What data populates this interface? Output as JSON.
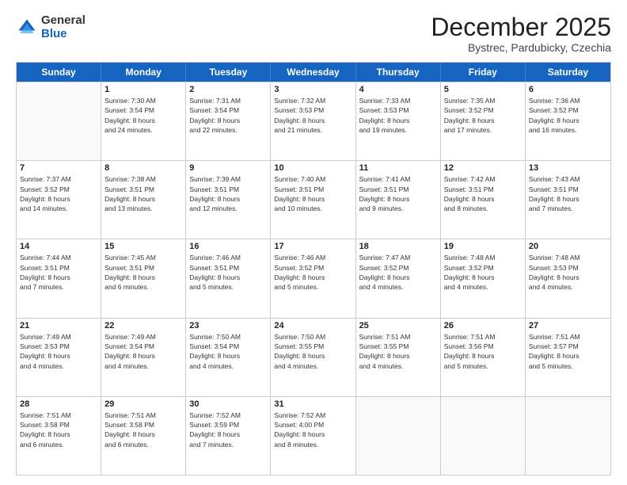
{
  "logo": {
    "general": "General",
    "blue": "Blue"
  },
  "header": {
    "month": "December 2025",
    "location": "Bystrec, Pardubicky, Czechia"
  },
  "weekdays": [
    "Sunday",
    "Monday",
    "Tuesday",
    "Wednesday",
    "Thursday",
    "Friday",
    "Saturday"
  ],
  "weeks": [
    [
      {
        "date": "",
        "info": ""
      },
      {
        "date": "1",
        "info": "Sunrise: 7:30 AM\nSunset: 3:54 PM\nDaylight: 8 hours\nand 24 minutes."
      },
      {
        "date": "2",
        "info": "Sunrise: 7:31 AM\nSunset: 3:54 PM\nDaylight: 8 hours\nand 22 minutes."
      },
      {
        "date": "3",
        "info": "Sunrise: 7:32 AM\nSunset: 3:53 PM\nDaylight: 8 hours\nand 21 minutes."
      },
      {
        "date": "4",
        "info": "Sunrise: 7:33 AM\nSunset: 3:53 PM\nDaylight: 8 hours\nand 19 minutes."
      },
      {
        "date": "5",
        "info": "Sunrise: 7:35 AM\nSunset: 3:52 PM\nDaylight: 8 hours\nand 17 minutes."
      },
      {
        "date": "6",
        "info": "Sunrise: 7:36 AM\nSunset: 3:52 PM\nDaylight: 8 hours\nand 16 minutes."
      }
    ],
    [
      {
        "date": "7",
        "info": "Sunrise: 7:37 AM\nSunset: 3:52 PM\nDaylight: 8 hours\nand 14 minutes."
      },
      {
        "date": "8",
        "info": "Sunrise: 7:38 AM\nSunset: 3:51 PM\nDaylight: 8 hours\nand 13 minutes."
      },
      {
        "date": "9",
        "info": "Sunrise: 7:39 AM\nSunset: 3:51 PM\nDaylight: 8 hours\nand 12 minutes."
      },
      {
        "date": "10",
        "info": "Sunrise: 7:40 AM\nSunset: 3:51 PM\nDaylight: 8 hours\nand 10 minutes."
      },
      {
        "date": "11",
        "info": "Sunrise: 7:41 AM\nSunset: 3:51 PM\nDaylight: 8 hours\nand 9 minutes."
      },
      {
        "date": "12",
        "info": "Sunrise: 7:42 AM\nSunset: 3:51 PM\nDaylight: 8 hours\nand 8 minutes."
      },
      {
        "date": "13",
        "info": "Sunrise: 7:43 AM\nSunset: 3:51 PM\nDaylight: 8 hours\nand 7 minutes."
      }
    ],
    [
      {
        "date": "14",
        "info": "Sunrise: 7:44 AM\nSunset: 3:51 PM\nDaylight: 8 hours\nand 7 minutes."
      },
      {
        "date": "15",
        "info": "Sunrise: 7:45 AM\nSunset: 3:51 PM\nDaylight: 8 hours\nand 6 minutes."
      },
      {
        "date": "16",
        "info": "Sunrise: 7:46 AM\nSunset: 3:51 PM\nDaylight: 8 hours\nand 5 minutes."
      },
      {
        "date": "17",
        "info": "Sunrise: 7:46 AM\nSunset: 3:52 PM\nDaylight: 8 hours\nand 5 minutes."
      },
      {
        "date": "18",
        "info": "Sunrise: 7:47 AM\nSunset: 3:52 PM\nDaylight: 8 hours\nand 4 minutes."
      },
      {
        "date": "19",
        "info": "Sunrise: 7:48 AM\nSunset: 3:52 PM\nDaylight: 8 hours\nand 4 minutes."
      },
      {
        "date": "20",
        "info": "Sunrise: 7:48 AM\nSunset: 3:53 PM\nDaylight: 8 hours\nand 4 minutes."
      }
    ],
    [
      {
        "date": "21",
        "info": "Sunrise: 7:49 AM\nSunset: 3:53 PM\nDaylight: 8 hours\nand 4 minutes."
      },
      {
        "date": "22",
        "info": "Sunrise: 7:49 AM\nSunset: 3:54 PM\nDaylight: 8 hours\nand 4 minutes."
      },
      {
        "date": "23",
        "info": "Sunrise: 7:50 AM\nSunset: 3:54 PM\nDaylight: 8 hours\nand 4 minutes."
      },
      {
        "date": "24",
        "info": "Sunrise: 7:50 AM\nSunset: 3:55 PM\nDaylight: 8 hours\nand 4 minutes."
      },
      {
        "date": "25",
        "info": "Sunrise: 7:51 AM\nSunset: 3:55 PM\nDaylight: 8 hours\nand 4 minutes."
      },
      {
        "date": "26",
        "info": "Sunrise: 7:51 AM\nSunset: 3:56 PM\nDaylight: 8 hours\nand 5 minutes."
      },
      {
        "date": "27",
        "info": "Sunrise: 7:51 AM\nSunset: 3:57 PM\nDaylight: 8 hours\nand 5 minutes."
      }
    ],
    [
      {
        "date": "28",
        "info": "Sunrise: 7:51 AM\nSunset: 3:58 PM\nDaylight: 8 hours\nand 6 minutes."
      },
      {
        "date": "29",
        "info": "Sunrise: 7:51 AM\nSunset: 3:58 PM\nDaylight: 8 hours\nand 6 minutes."
      },
      {
        "date": "30",
        "info": "Sunrise: 7:52 AM\nSunset: 3:59 PM\nDaylight: 8 hours\nand 7 minutes."
      },
      {
        "date": "31",
        "info": "Sunrise: 7:52 AM\nSunset: 4:00 PM\nDaylight: 8 hours\nand 8 minutes."
      },
      {
        "date": "",
        "info": ""
      },
      {
        "date": "",
        "info": ""
      },
      {
        "date": "",
        "info": ""
      }
    ]
  ]
}
